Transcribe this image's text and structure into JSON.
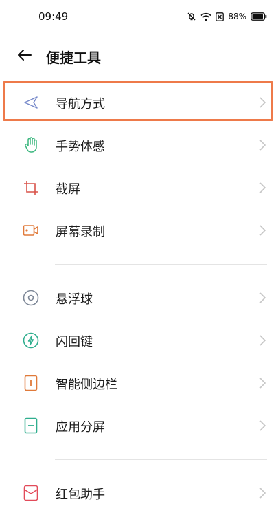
{
  "status_bar": {
    "time": "09:49",
    "battery": "88%",
    "icons": [
      "dnd-bell-off-icon",
      "wifi-icon",
      "sim-icon",
      "battery-icon"
    ]
  },
  "header": {
    "back_icon": "arrow-left-icon",
    "title": "便捷工具"
  },
  "items": [
    {
      "label": "导航方式",
      "icon": "navigation-arrow-icon",
      "color": "#7386c9",
      "highlighted": true
    },
    {
      "label": "手势体感",
      "icon": "hand-icon",
      "color": "#3cb77f"
    },
    {
      "label": "截屏",
      "icon": "crop-icon",
      "color": "#d9534a"
    },
    {
      "label": "屏幕录制",
      "icon": "video-record-icon",
      "color": "#e07a3a"
    },
    {
      "label": "悬浮球",
      "icon": "floating-ball-icon",
      "color": "#7d8797"
    },
    {
      "label": "闪回键",
      "icon": "flash-icon",
      "color": "#2fae8e"
    },
    {
      "label": "智能侧边栏",
      "icon": "sidebar-icon",
      "color": "#e07a3a"
    },
    {
      "label": "应用分屏",
      "icon": "split-screen-icon",
      "color": "#2fae8e"
    },
    {
      "label": "红包助手",
      "icon": "envelope-icon",
      "color": "#e24b5a"
    }
  ],
  "highlight_color": "#ee7a4a"
}
